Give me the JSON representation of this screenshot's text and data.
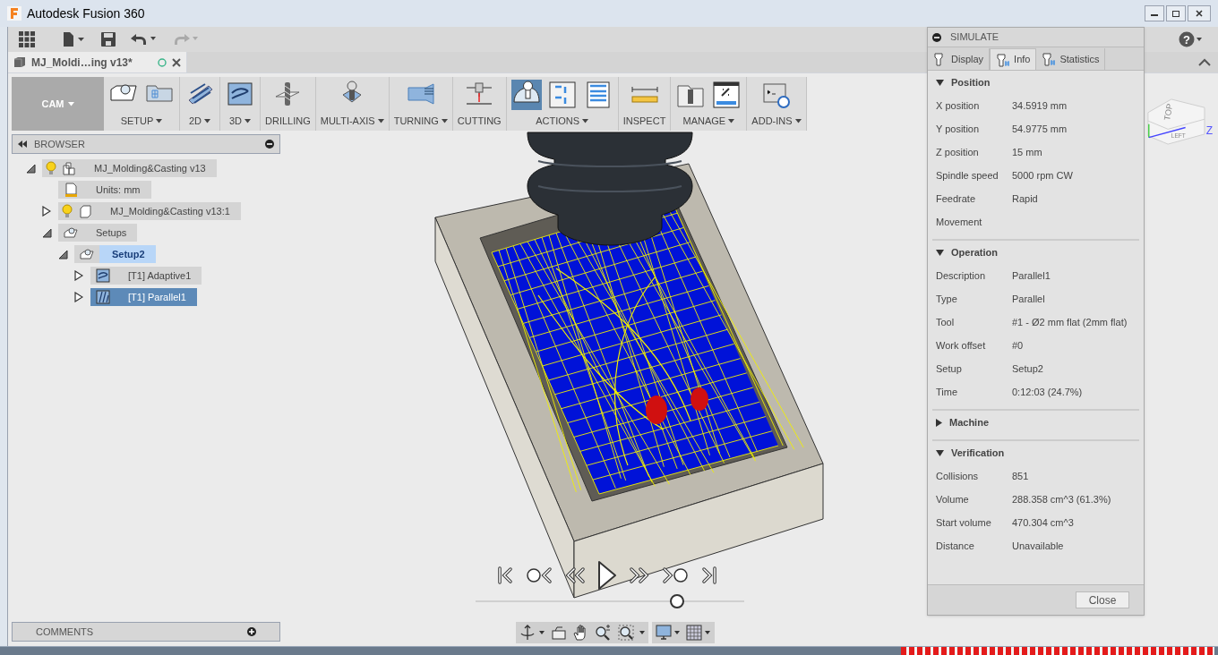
{
  "window": {
    "title": "Autodesk Fusion 360"
  },
  "toolbar": {
    "help": "?"
  },
  "document_tab": {
    "title": "MJ_Moldi…ing v13*"
  },
  "ribbon": {
    "workspace": "CAM",
    "groups": [
      {
        "label": "SETUP",
        "menu": true,
        "tools": [
          {
            "kind": "setup",
            "selected": false
          },
          {
            "kind": "folder",
            "selected": false
          }
        ]
      },
      {
        "label": "2D",
        "menu": true,
        "tools": [
          {
            "kind": "pocket",
            "selected": false
          }
        ]
      },
      {
        "label": "3D",
        "menu": true,
        "tools": [
          {
            "kind": "surface",
            "selected": false
          }
        ]
      },
      {
        "label": "DRILLING",
        "menu": false,
        "tools": [
          {
            "kind": "drill",
            "selected": false
          }
        ]
      },
      {
        "label": "MULTI-AXIS",
        "menu": true,
        "tools": [
          {
            "kind": "multiaxis",
            "selected": false
          }
        ]
      },
      {
        "label": "TURNING",
        "menu": true,
        "tools": [
          {
            "kind": "turning",
            "selected": false
          }
        ]
      },
      {
        "label": "CUTTING",
        "menu": false,
        "tools": [
          {
            "kind": "cutting",
            "selected": false
          }
        ]
      },
      {
        "label": "ACTIONS",
        "menu": true,
        "tools": [
          {
            "kind": "simulate",
            "selected": true
          },
          {
            "kind": "gcode",
            "selected": false
          },
          {
            "kind": "sheet",
            "selected": false
          }
        ]
      },
      {
        "label": "INSPECT",
        "menu": false,
        "tools": [
          {
            "kind": "ruler",
            "selected": false
          }
        ]
      },
      {
        "label": "MANAGE",
        "menu": true,
        "tools": [
          {
            "kind": "library",
            "selected": false
          },
          {
            "kind": "post",
            "selected": false
          }
        ]
      },
      {
        "label": "ADD-INS",
        "menu": true,
        "tools": [
          {
            "kind": "addins",
            "selected": false
          }
        ]
      }
    ]
  },
  "browser": {
    "title": "BROWSER",
    "tree": [
      {
        "label": "MJ_Molding&Casting v13",
        "kind": "component",
        "light": true,
        "expanded": true,
        "selected": false,
        "active": false,
        "children": [
          {
            "label": "Units: mm",
            "kind": "units",
            "light": false,
            "selected": false,
            "active": false
          },
          {
            "label": "MJ_Molding&Casting v13:1",
            "kind": "body",
            "light": true,
            "expanded": false,
            "selected": false,
            "active": false
          },
          {
            "label": "Setups",
            "kind": "setup",
            "light": false,
            "expanded": true,
            "selected": false,
            "active": false,
            "children": [
              {
                "label": "Setup2",
                "kind": "setup",
                "light": false,
                "expanded": true,
                "selected": false,
                "active": true,
                "children": [
                  {
                    "label": "[T1] Adaptive1",
                    "kind": "adaptive",
                    "light": false,
                    "expanded": false,
                    "selected": false,
                    "active": false
                  },
                  {
                    "label": "[T1] Parallel1",
                    "kind": "parallel",
                    "light": false,
                    "expanded": false,
                    "selected": true,
                    "active": false
                  }
                ]
              }
            ]
          }
        ]
      }
    ]
  },
  "comments": {
    "title": "COMMENTS"
  },
  "viewcube": {
    "top": "TOP",
    "left": "LEFT",
    "axis": "Z"
  },
  "simulation": {
    "level": 0.75
  },
  "simulate_panel": {
    "title": "SIMULATE",
    "tabs": [
      {
        "label": "Display",
        "selected": false
      },
      {
        "label": "Info",
        "selected": true
      },
      {
        "label": "Statistics",
        "selected": false
      }
    ],
    "sections": [
      {
        "title": "Position",
        "expanded": true,
        "rows": [
          {
            "label": "X position",
            "value": "34.5919 mm"
          },
          {
            "label": "Y position",
            "value": "54.9775 mm"
          },
          {
            "label": "Z position",
            "value": "15 mm"
          },
          {
            "label": "Spindle speed",
            "value": "5000 rpm CW"
          },
          {
            "label": "Feedrate",
            "value": "Rapid"
          },
          {
            "label": "Movement"
          }
        ]
      },
      {
        "title": "Operation",
        "expanded": true,
        "rows": [
          {
            "label": "Description",
            "value": "Parallel1"
          },
          {
            "label": "Type",
            "value": "Parallel"
          },
          {
            "label": "Tool",
            "value": "#1 - Ø2 mm flat (2mm flat)"
          },
          {
            "label": "Work offset",
            "value": "#0"
          },
          {
            "label": "Setup",
            "value": "Setup2"
          },
          {
            "label": "Time",
            "value": "0:12:03 (24.7%)"
          }
        ]
      },
      {
        "title": "Machine",
        "expanded": false
      },
      {
        "title": "Verification",
        "expanded": true,
        "rows": [
          {
            "label": "Collisions",
            "value": "851"
          },
          {
            "label": "Volume",
            "value": "288.358 cm^3 (61.3%)"
          },
          {
            "label": "Start volume",
            "value": "470.304 cm^3"
          },
          {
            "label": "Distance",
            "value": "Unavailable"
          }
        ]
      }
    ],
    "close_button": "Close"
  }
}
